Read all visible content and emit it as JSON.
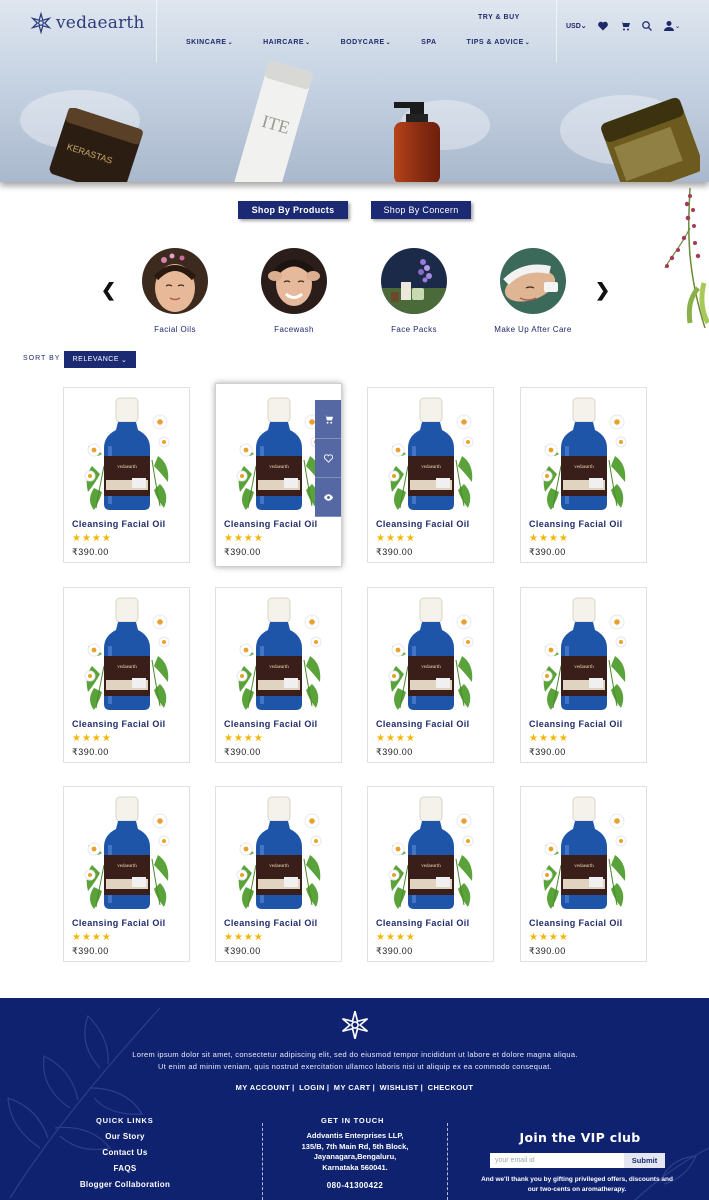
{
  "header": {
    "brand": "vedaearth",
    "try_buy": "TRY & BUY",
    "nav": [
      "SKINCARE",
      "HAIRCARE",
      "BODYCARE",
      "SPA",
      "TIPS & ADVICE"
    ],
    "nav_has_dropdown": [
      true,
      true,
      true,
      false,
      true
    ],
    "currency": "USD",
    "icons": [
      "heart-icon",
      "cart-icon",
      "search-icon",
      "user-icon"
    ]
  },
  "tabs": {
    "by_products": "Shop By Products",
    "by_concern": "Shop By Concern"
  },
  "categories": [
    {
      "label": "Facial Oils"
    },
    {
      "label": "Facewash"
    },
    {
      "label": "Face Packs"
    },
    {
      "label": "Make Up After Care"
    }
  ],
  "sort": {
    "label": "SORT BY",
    "value": "RELEVANCE"
  },
  "products": [
    {
      "name": "Cleansing Facial Oil",
      "rating": 4,
      "stars": "★★★★",
      "price": "₹390.00"
    },
    {
      "name": "Cleansing Facial Oil",
      "rating": 4,
      "stars": "★★★★",
      "price": "₹390.00"
    },
    {
      "name": "Cleansing Facial Oil",
      "rating": 4,
      "stars": "★★★★",
      "price": "₹390.00"
    },
    {
      "name": "Cleansing Facial Oil",
      "rating": 4,
      "stars": "★★★★",
      "price": "₹390.00"
    },
    {
      "name": "Cleansing Facial Oil",
      "rating": 4,
      "stars": "★★★★",
      "price": "₹390.00"
    },
    {
      "name": "Cleansing Facial Oil",
      "rating": 4,
      "stars": "★★★★",
      "price": "₹390.00"
    },
    {
      "name": "Cleansing Facial Oil",
      "rating": 4,
      "stars": "★★★★",
      "price": "₹390.00"
    },
    {
      "name": "Cleansing Facial Oil",
      "rating": 4,
      "stars": "★★★★",
      "price": "₹390.00"
    },
    {
      "name": "Cleansing Facial Oil",
      "rating": 4,
      "stars": "★★★★",
      "price": "₹390.00"
    },
    {
      "name": "Cleansing Facial Oil",
      "rating": 4,
      "stars": "★★★★",
      "price": "₹390.00"
    },
    {
      "name": "Cleansing Facial Oil",
      "rating": 4,
      "stars": "★★★★",
      "price": "₹390.00"
    },
    {
      "name": "Cleansing Facial Oil",
      "rating": 4,
      "stars": "★★★★",
      "price": "₹390.00"
    }
  ],
  "footer": {
    "about_line1": "Lorem ipsum dolor sit amet, consectetur adipiscing elit, sed do eiusmod tempor incididunt ut labore et dolore magna aliqua.",
    "about_line2": "Ut enim ad minim veniam, quis nostrud exercitation ullamco laboris nisi ut aliquip ex ea commodo consequat.",
    "links": [
      "MY ACCOUNT",
      "LOGIN",
      "MY CART",
      "WISHLIST",
      "CHECKOUT"
    ],
    "quick_links_title": "QUICK LINKS",
    "quick_links": [
      "Our Story",
      "Contact Us",
      "FAQS",
      "Blogger Collaboration"
    ],
    "get_in_touch_title": "GET IN TOUCH",
    "address": [
      "Addvantis Enterprises LLP,",
      "135/B, 7th Main Rd, 5th Block,",
      "Jayanagara,Bengaluru,",
      "Karnataka 560041."
    ],
    "phone": "080-41300422",
    "vip_title": "Join the VIP club",
    "email_placeholder": "your email id",
    "submit": "Submit",
    "vip_note_line1": "And we'll thank you by gifting privileged offers, discounts and",
    "vip_note_line2": "our two-cents on aromatherapy."
  },
  "colors": {
    "brand_navy": "#1b2a72",
    "footer_bg": "#0f2270",
    "star": "#f2b705",
    "hover_panel": "#5568a4"
  }
}
